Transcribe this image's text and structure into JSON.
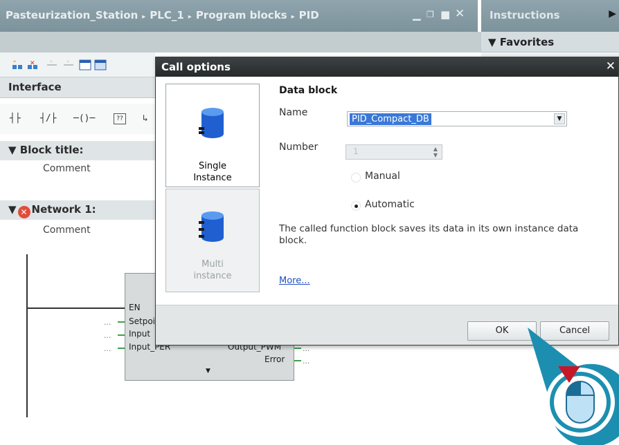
{
  "titlebar": {
    "breadcrumb": [
      "Pasteurization_Station",
      "PLC_1",
      "Program blocks",
      "PID"
    ],
    "sep": "▸"
  },
  "right_panel": {
    "instructions_tab": "Instructions",
    "favorites": "Favorites"
  },
  "editor": {
    "interface_label": "Interface",
    "ladder_symbols": [
      "┤├",
      "┤/├",
      "─()─",
      "??"
    ],
    "block_title": "Block title:",
    "block_comment": "Comment",
    "network_title": "Network 1:",
    "network_comment": "Comment",
    "fb_pins_left": [
      "EN",
      "Setpoint",
      "Input",
      "Input_PER"
    ],
    "fb_pins_right": [
      "Output_PWM",
      "Error"
    ],
    "pin_placeholder": "..."
  },
  "dialog": {
    "title": "Call options",
    "options": [
      {
        "label_line1": "Single",
        "label_line2": "Instance",
        "selected": true
      },
      {
        "label_line1": "Multi",
        "label_line2": "instance",
        "selected": false
      }
    ],
    "section_title": "Data block",
    "name_label": "Name",
    "name_value": "PID_Compact_DB",
    "number_label": "Number",
    "number_value": "1",
    "radio_manual": "Manual",
    "radio_automatic": "Automatic",
    "radio_selected": "Automatic",
    "description": "The called function block saves its data in its own instance data block.",
    "more_link": "More...",
    "ok_label": "OK",
    "cancel_label": "Cancel"
  },
  "colors": {
    "titlebar": "#8fa4ad",
    "dialog_title": "#2f3435",
    "selection": "#3a78d8",
    "error": "#e34c3a",
    "callout_ring": "#1c8fb0",
    "pointer_arrow": "#c4182a"
  }
}
